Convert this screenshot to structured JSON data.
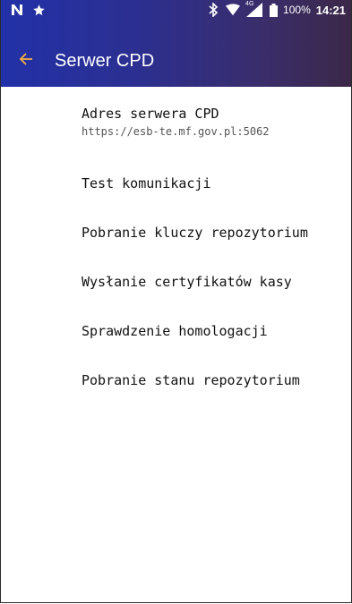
{
  "status_bar": {
    "left_icons": [
      "n-notification-icon",
      "star-icon"
    ],
    "right_icons": [
      "bluetooth-icon",
      "wifi-icon",
      "signal-icon",
      "battery-icon"
    ],
    "signal_label": "4G",
    "battery": "100%",
    "time": "14:21"
  },
  "toolbar": {
    "title": "Serwer CPD",
    "accent_color": "#f5b042"
  },
  "menu": {
    "items": [
      {
        "label": "Adres serwera CPD",
        "subtitle": "https://esb-te.mf.gov.pl:5062"
      },
      {
        "label": "Test komunikacji"
      },
      {
        "label": "Pobranie kluczy repozytorium"
      },
      {
        "label": "Wysłanie certyfikatów kasy"
      },
      {
        "label": "Sprawdzenie homologacji"
      },
      {
        "label": "Pobranie stanu repozytorium"
      }
    ]
  }
}
